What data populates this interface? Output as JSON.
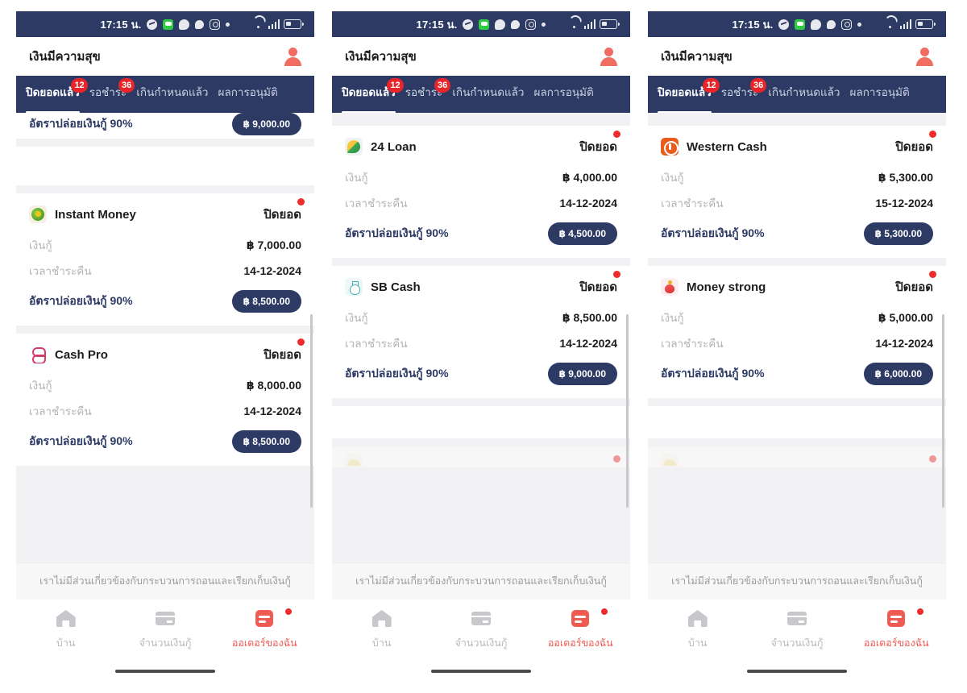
{
  "colors": {
    "header_navy": "#2c3a64",
    "accent_red": "#ef5b52",
    "badge_red": "#e8252a",
    "page_bg": "#f2f2f4",
    "muted_text": "#b3b3b8"
  },
  "status_bar": {
    "time": "17:15 น.",
    "left_icons": [
      "messenger-icon",
      "line-icon",
      "chat-bubble-icon",
      "chat-bubble-icon",
      "instagram-icon",
      "dot-icon"
    ],
    "right_icons": [
      "wifi-icon",
      "signal-icon",
      "battery-icon"
    ]
  },
  "app_bar": {
    "title": "เงินมีความสุข",
    "avatar_icon": "user-avatar-icon"
  },
  "tabs": [
    {
      "label": "ปิดยอดแล้ว",
      "badge": "12",
      "active": true
    },
    {
      "label": "รอชำระ",
      "badge": "36",
      "active": false
    },
    {
      "label": "เกินกำหนดแล้ว",
      "badge": "",
      "active": false
    },
    {
      "label": "ผลการอนุมัติ",
      "badge": "",
      "active": false
    }
  ],
  "row_labels": {
    "loan": "เงินกู้",
    "repay_date": "เวลาชำระคืน",
    "rate": "อัตราปล่อยเงินกู้ 90%"
  },
  "status_text": "ปิดยอด",
  "footer_note": "เราไม่มีส่วนเกี่ยวข้องกับกระบวนการถอนและเรียกเก็บเงินกู้",
  "bottom_nav": [
    {
      "label": "บ้าน",
      "icon": "home-icon",
      "active": false,
      "dot": false
    },
    {
      "label": "จำนวนเงินกู้",
      "icon": "credit-card-icon",
      "active": false,
      "dot": false
    },
    {
      "label": "ออเดอร์ของฉัน",
      "icon": "order-list-icon",
      "active": true,
      "dot": true
    }
  ],
  "panels": [
    {
      "partial_top": {
        "rate": "อัตราปล่อยเงินกู้ 90%",
        "amount": "฿ 9,000.00"
      },
      "cards": [
        {
          "logo": "instant-money-logo",
          "logo_class": "logo-instant",
          "name": "Instant Money",
          "status": "ปิดยอด",
          "loan": "฿ 7,000.00",
          "repay_date": "14-12-2024",
          "rate": "อัตราปล่อยเงินกู้ 90%",
          "amount": "฿ 8,500.00"
        },
        {
          "logo": "cash-pro-logo",
          "logo_class": "logo-cashpro",
          "name": "Cash Pro",
          "status": "ปิดยอด",
          "loan": "฿ 8,000.00",
          "repay_date": "14-12-2024",
          "rate": "อัตราปล่อยเงินกู้ 90%",
          "amount": "฿ 8,500.00"
        }
      ],
      "partial_bottom": null
    },
    {
      "partial_top": null,
      "cards": [
        {
          "logo": "24-loan-logo",
          "logo_class": "logo-24loan",
          "name": "24 Loan",
          "status": "ปิดยอด",
          "loan": "฿ 4,000.00",
          "repay_date": "14-12-2024",
          "rate": "อัตราปล่อยเงินกู้ 90%",
          "amount": "฿ 4,500.00"
        },
        {
          "logo": "sb-cash-logo",
          "logo_class": "logo-sbcash",
          "name": "SB Cash",
          "status": "ปิดยอด",
          "loan": "฿ 8,500.00",
          "repay_date": "14-12-2024",
          "rate": "อัตราปล่อยเงินกู้ 90%",
          "amount": "฿ 9,000.00"
        }
      ],
      "partial_bottom": {
        "logo_class": "logo-partial"
      }
    },
    {
      "partial_top": null,
      "cards": [
        {
          "logo": "western-cash-logo",
          "logo_class": "logo-western",
          "name": "Western Cash",
          "status": "ปิดยอด",
          "loan": "฿ 5,300.00",
          "repay_date": "15-12-2024",
          "rate": "อัตราปล่อยเงินกู้ 90%",
          "amount": "฿ 5,300.00"
        },
        {
          "logo": "money-strong-logo",
          "logo_class": "logo-moneystrong",
          "name": "Money strong",
          "status": "ปิดยอด",
          "loan": "฿ 5,000.00",
          "repay_date": "14-12-2024",
          "rate": "อัตราปล่อยเงินกู้ 90%",
          "amount": "฿ 6,000.00"
        }
      ],
      "partial_bottom": {
        "logo_class": "logo-partial"
      }
    }
  ]
}
